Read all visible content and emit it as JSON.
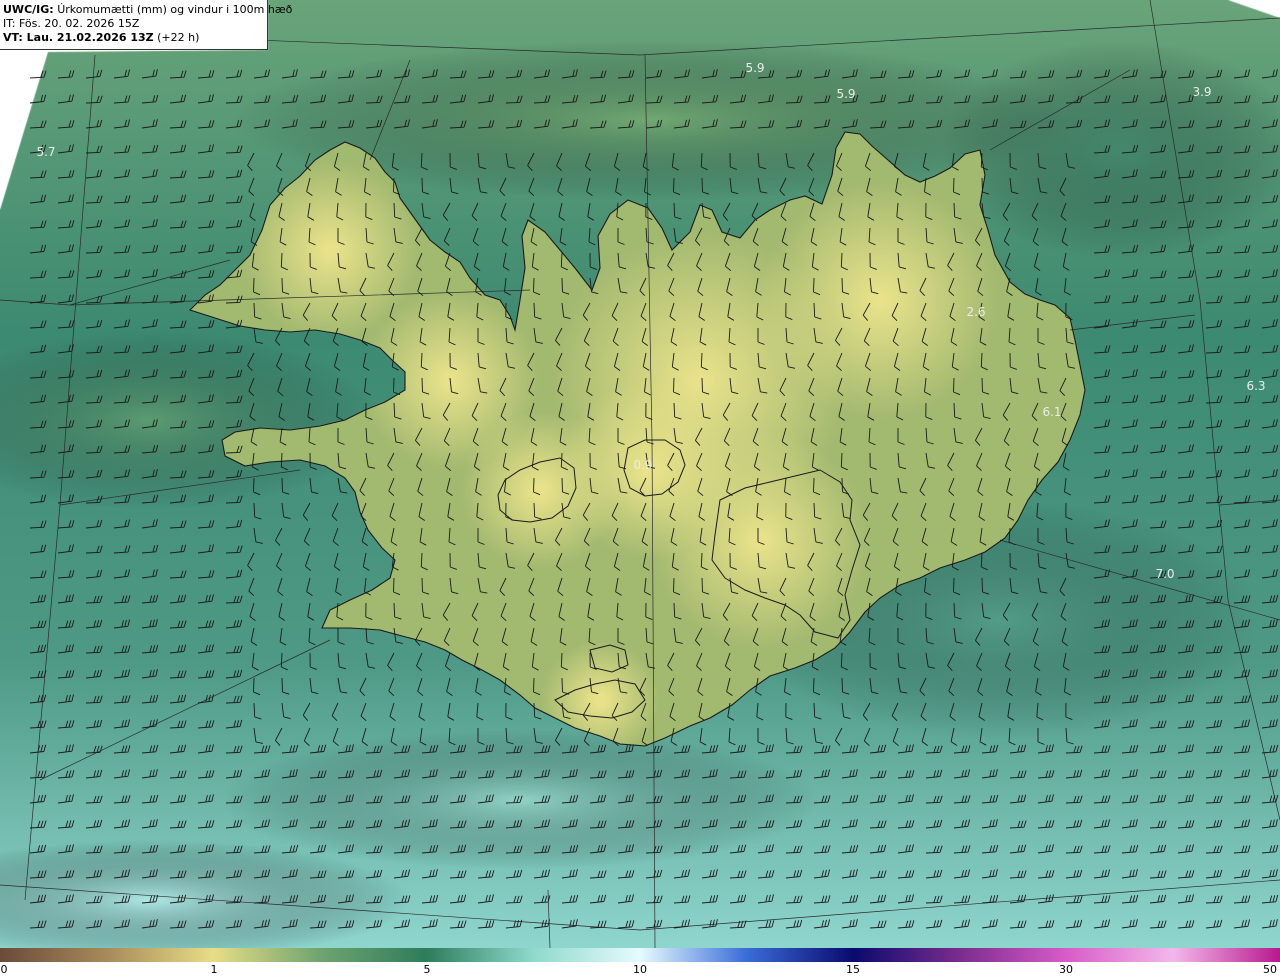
{
  "header": {
    "model": "UWC/IG:",
    "title": "Úrkomumætti (mm) og vindur i 100m hæð",
    "issue_time": "IT: Fös. 20. 02. 2026 15Z",
    "valid_prefix": "VT: Lau. 21.02.2026 13Z",
    "valid_suffix": "(+22 h)"
  },
  "value_labels": [
    {
      "text": "5.9"
    },
    {
      "text": "5.9"
    },
    {
      "text": "3.9"
    },
    {
      "text": "5.7"
    },
    {
      "text": "2.6"
    },
    {
      "text": "6.3"
    },
    {
      "text": "6.1"
    },
    {
      "text": "0.9"
    },
    {
      "text": "7.0"
    }
  ],
  "colorbar": {
    "ticks": [
      "0",
      "1",
      "5",
      "10",
      "15",
      "30",
      "50"
    ],
    "colors": [
      "#6b4a3a",
      "#a88a5a",
      "#e7dd86",
      "#6fa46f",
      "#2e7c5c",
      "#8fd9cc",
      "#e6fbff",
      "#3a6cd8",
      "#0a0a6e",
      "#7b2c8e",
      "#d85cc8",
      "#f2b8ea",
      "#b8188e"
    ]
  },
  "map_colors": {
    "sea": "#3f8c73",
    "sea_light": "#a8e6dd",
    "land_low": "#a2b970",
    "land_high": "#e4df8c",
    "coast": "#1a1a1a"
  }
}
